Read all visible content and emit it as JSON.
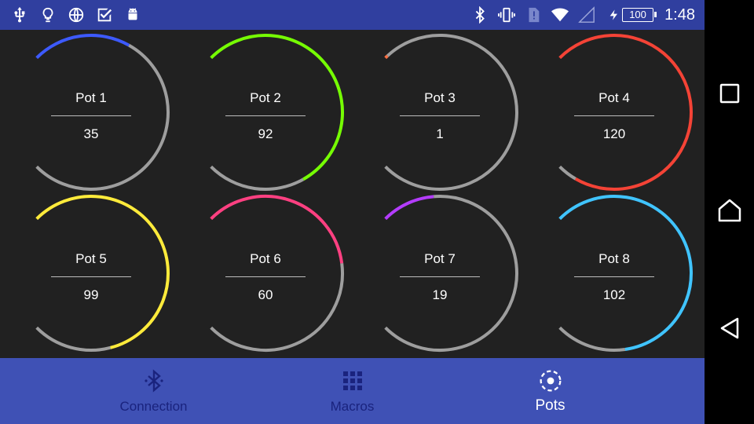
{
  "status_bar": {
    "left_icons": [
      "usb-icon",
      "lightbulb-icon",
      "globe-icon",
      "check-box-icon",
      "android-icon"
    ],
    "right_icons": [
      "bluetooth-icon",
      "vibrate-icon",
      "sim-alert-icon",
      "wifi-icon",
      "cell-signal-icon"
    ],
    "battery_level": "100",
    "time": "1:48"
  },
  "pots": [
    {
      "label": "Pot 1",
      "value": "35",
      "color": "#3d5afe"
    },
    {
      "label": "Pot 2",
      "value": "92",
      "color": "#76ff03"
    },
    {
      "label": "Pot 3",
      "value": "1",
      "color": "#ff7043"
    },
    {
      "label": "Pot 4",
      "value": "120",
      "color": "#f44336"
    },
    {
      "label": "Pot 5",
      "value": "99",
      "color": "#ffeb3b"
    },
    {
      "label": "Pot 6",
      "value": "60",
      "color": "#ff4081"
    },
    {
      "label": "Pot 7",
      "value": "19",
      "color": "#b43cff"
    },
    {
      "label": "Pot 8",
      "value": "102",
      "color": "#40c4ff"
    }
  ],
  "pot_max": 127,
  "track_color": "#9e9e9e",
  "bottom_nav": {
    "tabs": [
      {
        "label": "Connection",
        "icon": "bluetooth-icon",
        "active": false
      },
      {
        "label": "Macros",
        "icon": "grid-icon",
        "active": false
      },
      {
        "label": "Pots",
        "icon": "dial-icon",
        "active": true
      }
    ]
  },
  "system_nav": [
    "recents-icon",
    "home-icon",
    "back-icon"
  ],
  "colors": {
    "status_bar": "#303f9f",
    "bottom_nav": "#3f51b5",
    "content_bg": "#212121",
    "inactive_tab": "#1a237e"
  }
}
